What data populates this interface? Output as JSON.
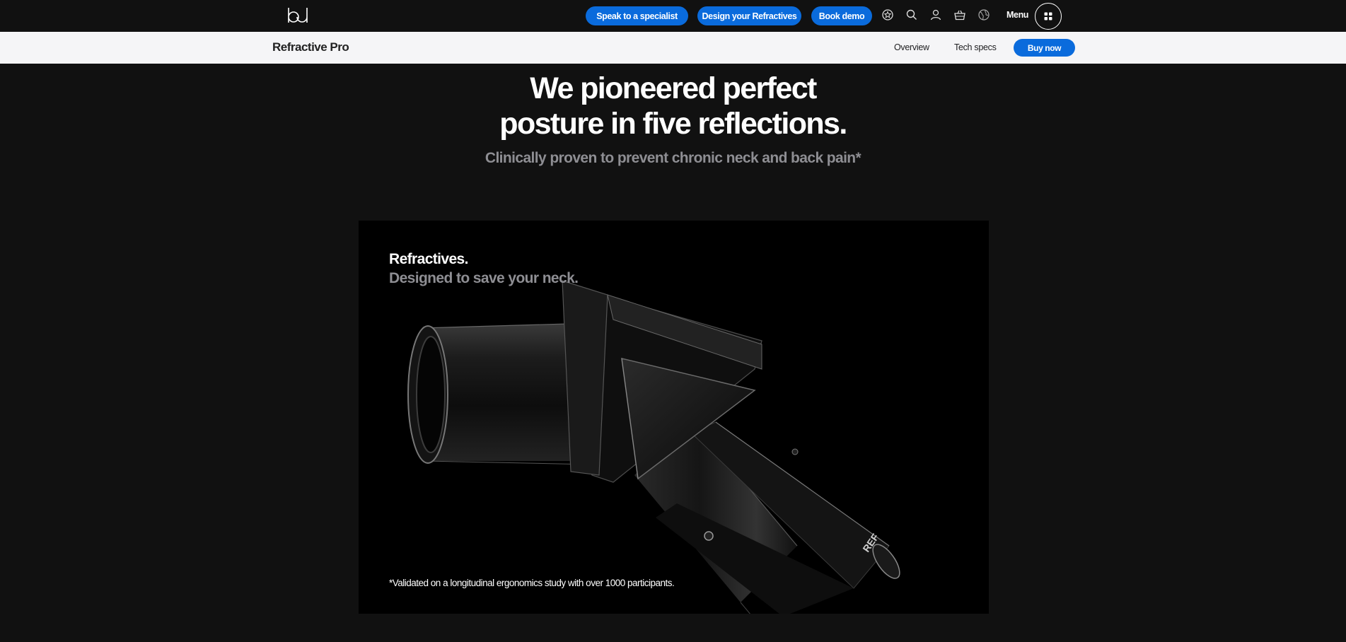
{
  "topnav": {
    "logo_icon": "bd-logo",
    "buttons": {
      "speak": "Speak to a specialist",
      "design": "Design your Refractives",
      "demo": "Book demo"
    },
    "icons": [
      "store-icon",
      "search-icon",
      "account-icon",
      "basket-icon",
      "globe-icon"
    ],
    "menu_label": "Menu",
    "menu_icon": "grid-icon"
  },
  "subnav": {
    "product_name": "Refractive Pro",
    "links": {
      "overview": "Overview",
      "tech_specs": "Tech specs"
    },
    "buy_label": "Buy now"
  },
  "hero": {
    "headline_line1": "We pioneered perfect",
    "headline_line2": "posture in five reflections.",
    "subhead": "Clinically proven to prevent chronic neck and back pain*"
  },
  "panel": {
    "title": "Refractives.",
    "subtitle": "Designed to save your neck.",
    "footnote": "*Validated on a longitudinal ergonomics study with over 1000 participants.",
    "device_marking": "REF"
  },
  "colors": {
    "accent": "#0a6bdc",
    "background": "#111111",
    "subnav_bg": "#f5f5f7",
    "muted_text": "#8e8e93"
  }
}
